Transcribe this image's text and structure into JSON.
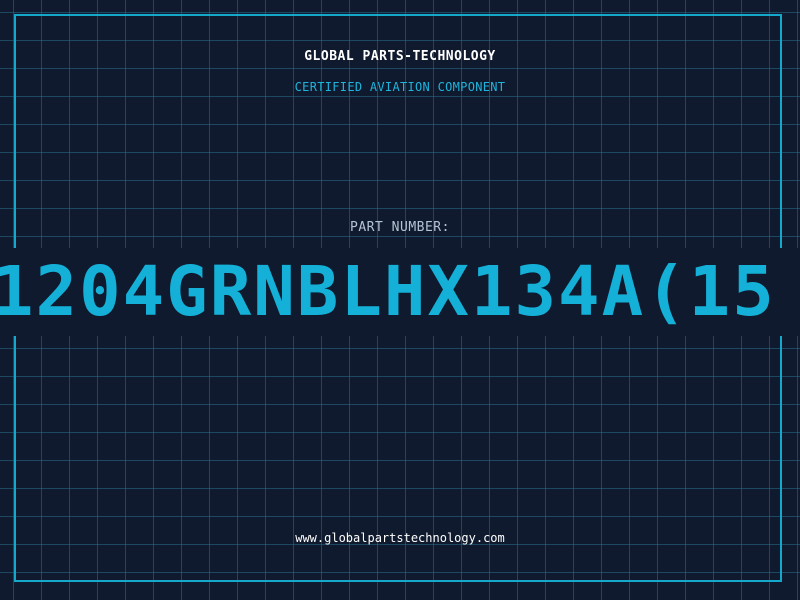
{
  "header": {
    "company": "GLOBAL PARTS-TECHNOLOGY",
    "subtitle": "CERTIFIED AVIATION COMPONENT"
  },
  "part": {
    "label": "PART NUMBER:",
    "number": "1204GRNBLHX134A(15"
  },
  "footer": {
    "url": "www.globalpartstechnology.com"
  },
  "colors": {
    "background": "#0f1a2e",
    "grid": "#286e8c",
    "accent": "#14b0d8",
    "text": "#ffffff",
    "label": "#b4c4d4"
  }
}
